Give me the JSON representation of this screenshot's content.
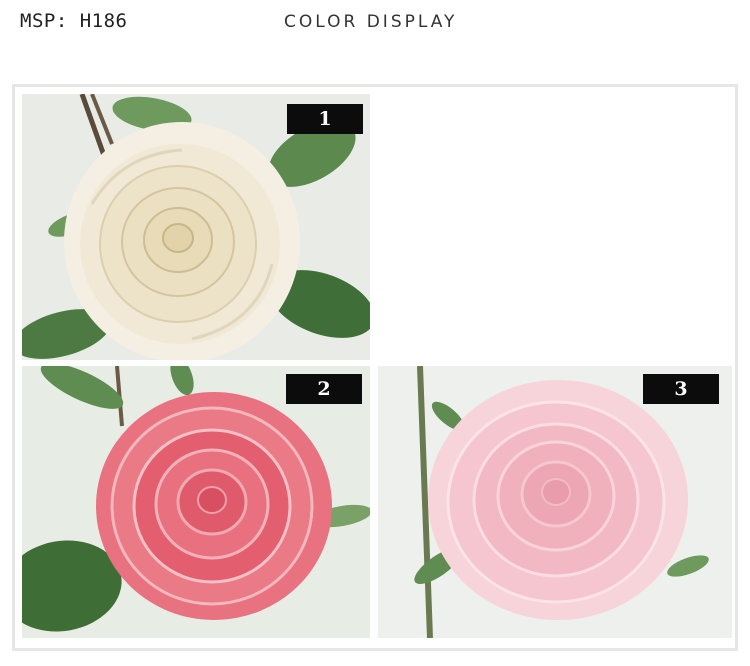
{
  "header": {
    "msp": "MSP: H186",
    "title": "COLOR DISPLAY"
  },
  "variants": [
    {
      "number": "1",
      "color": "#f3ead7"
    },
    {
      "number": "2",
      "color": "#e8707f"
    },
    {
      "number": "3",
      "color": "#f5c6cf"
    }
  ]
}
